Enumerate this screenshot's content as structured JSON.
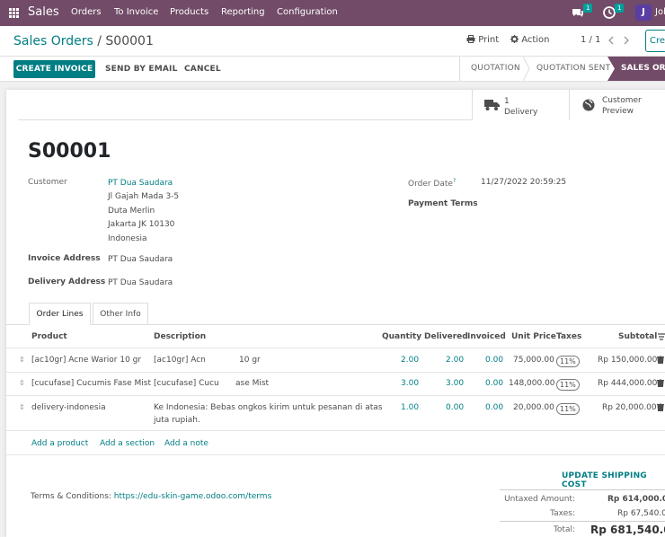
{
  "navbar": {
    "app_name": "Sales",
    "menu": [
      "Orders",
      "To Invoice",
      "Products",
      "Reporting",
      "Configuration"
    ],
    "chat_count": "1",
    "activity_count": "1",
    "avatar_letter": "J",
    "user_name": "John"
  },
  "control": {
    "breadcrumb_parent": "Sales Orders",
    "breadcrumb_sep": "/",
    "breadcrumb_current": "S00001",
    "print_label": "Print",
    "action_label": "Action",
    "pager": "1 / 1",
    "create_label": "Create"
  },
  "buttons": {
    "create_invoice": "CREATE INVOICE",
    "send_email": "SEND BY EMAIL",
    "cancel": "CANCEL"
  },
  "statusbar": {
    "stages": [
      "QUOTATION",
      "QUOTATION SENT",
      "SALES ORDER"
    ],
    "active_index": 2
  },
  "smart_buttons": {
    "delivery_count": "1",
    "delivery_label": "Delivery",
    "preview_line1": "Customer",
    "preview_line2": "Preview"
  },
  "order": {
    "name": "S00001",
    "customer_label": "Customer",
    "customer_name": "PT Dua Saudara",
    "address": [
      "Jl Gajah Mada 3-5",
      "Duta Merlin",
      "Jakarta JK 10130",
      "Indonesia"
    ],
    "invoice_address_label": "Invoice Address",
    "invoice_address": "PT Dua Saudara",
    "delivery_address_label": "Delivery Address",
    "delivery_address": "PT Dua Saudara",
    "order_date_label": "Order Date",
    "order_date_help": "?",
    "order_date": "11/27/2022 20:59:25",
    "payment_terms_label": "Payment Terms"
  },
  "tabs": [
    "Order Lines",
    "Other Info"
  ],
  "table": {
    "headers": [
      "Product",
      "Description",
      "Quantity",
      "Delivered",
      "Invoiced",
      "Unit Price",
      "Taxes",
      "Subtotal"
    ],
    "rows": [
      {
        "product": "[ac10gr] Acne Warior 10 gr",
        "description": "[ac10gr] Acn",
        "description2": "10 gr",
        "quantity": "2.00",
        "delivered": "2.00",
        "invoiced": "0.00",
        "unit_price": "75,000.00",
        "tax": "11%",
        "subtotal": "Rp 150,000.00"
      },
      {
        "product": "[cucufase] Cucumis Fase Mist",
        "description": "[cucufase] Cucu",
        "description2": "ase Mist",
        "quantity": "3.00",
        "delivered": "3.00",
        "invoiced": "0.00",
        "unit_price": "148,000.00",
        "tax": "11%",
        "subtotal": "Rp 444,000.00"
      },
      {
        "product": "delivery-indonesia",
        "description": "Ke Indonesia: Bebas ongkos kirim untuk pesanan di atas",
        "description2": "juta rupiah.",
        "quantity": "1.00",
        "delivered": "0.00",
        "invoiced": "0.00",
        "unit_price": "20,000.00",
        "tax": "11%",
        "subtotal": "Rp 20,000.00"
      }
    ],
    "add_product": "Add a product",
    "add_section": "Add a section",
    "add_note": "Add a note"
  },
  "footer": {
    "terms_label": "Terms & Conditions:",
    "terms_link": "https://edu-skin-game.odoo.com/terms",
    "update_shipping": "UPDATE SHIPPING COST",
    "untaxed_label": "Untaxed Amount:",
    "untaxed_value": "Rp 614,000.00",
    "taxes_label": "Taxes:",
    "taxes_value": "Rp 67,540.00",
    "total_label": "Total:",
    "total_value": "Rp 681,540.00"
  },
  "colors": {
    "brand": "#714b67",
    "accent": "#017e84"
  }
}
